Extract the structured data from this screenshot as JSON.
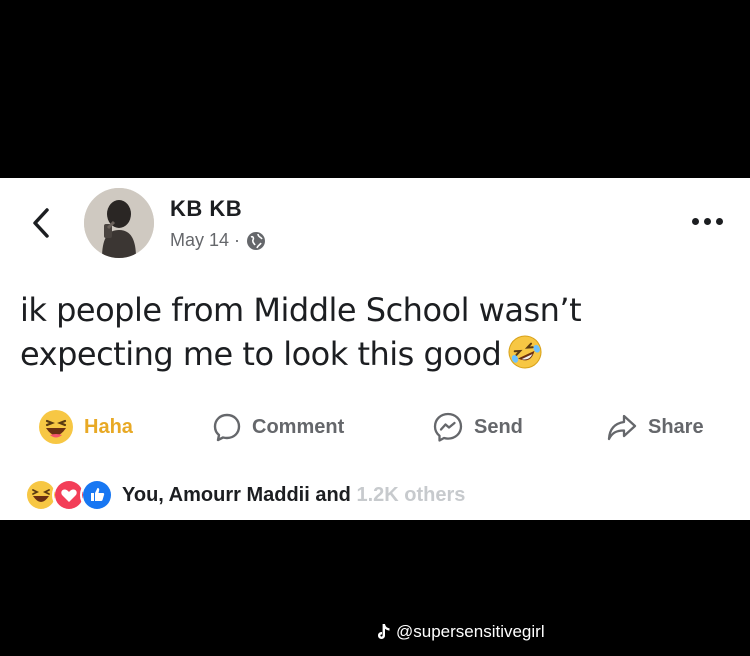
{
  "header": {
    "author_name": "KB KB",
    "date": "May 14 ·",
    "back_icon": "chevron-left-icon",
    "privacy_icon": "globe-icon",
    "more_icon": "more-horizontal-icon"
  },
  "post": {
    "text": "ik people from Middle School wasn’t expecting me to look this good",
    "emoji": "rolling-on-floor-laughing-emoji"
  },
  "actions": {
    "haha_label": "Haha",
    "comment_label": "Comment",
    "send_label": "Send",
    "share_label": "Share"
  },
  "reactions": {
    "icons": [
      "haha-icon",
      "love-icon",
      "like-icon"
    ],
    "names_text": "You, Amourr Maddii and ",
    "others_text": "1.2K others"
  },
  "watermark": {
    "handle": "@supersensitivegirl",
    "icon": "tiktok-icon"
  },
  "colors": {
    "haha_accent": "#e8a925",
    "text_primary": "#1c1e21",
    "text_secondary": "#65676b",
    "love_red": "#f33e58",
    "like_blue": "#1877f2"
  }
}
